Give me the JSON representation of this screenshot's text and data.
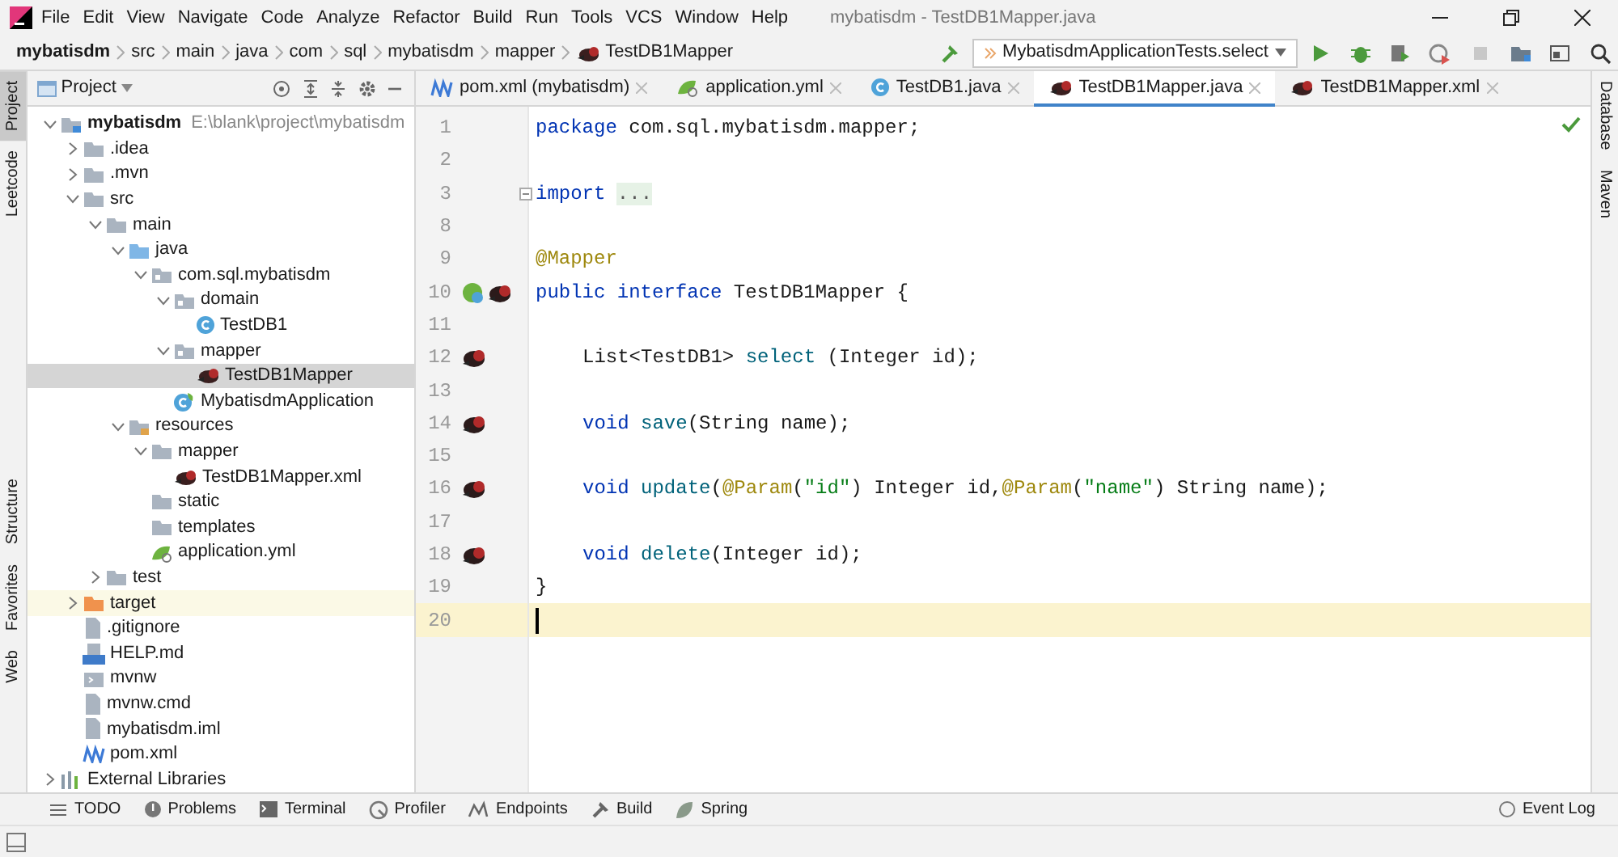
{
  "window": {
    "title": "mybatisdm - TestDB1Mapper.java"
  },
  "menu": [
    "File",
    "Edit",
    "View",
    "Navigate",
    "Code",
    "Analyze",
    "Refactor",
    "Build",
    "Run",
    "Tools",
    "VCS",
    "Window",
    "Help"
  ],
  "breadcrumbs": [
    {
      "label": "mybatisdm",
      "kind": "root"
    },
    {
      "label": "src",
      "kind": "folder"
    },
    {
      "label": "main",
      "kind": "folder"
    },
    {
      "label": "java",
      "kind": "folder"
    },
    {
      "label": "com",
      "kind": "folder"
    },
    {
      "label": "sql",
      "kind": "folder"
    },
    {
      "label": "mybatisdm",
      "kind": "folder"
    },
    {
      "label": "mapper",
      "kind": "folder"
    },
    {
      "label": "TestDB1Mapper",
      "kind": "mapper"
    }
  ],
  "run_config": "MybatisdmApplicationTests.select",
  "left_stripe": [
    {
      "label": "Project",
      "selected": true
    },
    {
      "label": "Leetcode",
      "selected": false
    },
    {
      "label": "Structure",
      "selected": false
    },
    {
      "label": "Favorites",
      "selected": false
    },
    {
      "label": "Web",
      "selected": false
    }
  ],
  "right_stripe": [
    "Database",
    "Maven"
  ],
  "project_panel": {
    "title": "Project",
    "tree": [
      {
        "label": "mybatisdm",
        "hint": "E:\\blank\\project\\mybatisdm",
        "kind": "module",
        "expanded": true,
        "selected": false,
        "highlighted": false,
        "children": [
          {
            "label": ".idea",
            "kind": "folder",
            "expanded": false,
            "selected": false,
            "highlighted": false
          },
          {
            "label": ".mvn",
            "kind": "folder",
            "expanded": false,
            "selected": false,
            "highlighted": false
          },
          {
            "label": "src",
            "kind": "folder",
            "expanded": true,
            "selected": false,
            "highlighted": false,
            "children": [
              {
                "label": "main",
                "kind": "folder",
                "expanded": true,
                "selected": false,
                "highlighted": false,
                "children": [
                  {
                    "label": "java",
                    "kind": "source",
                    "expanded": true,
                    "selected": false,
                    "highlighted": false,
                    "children": [
                      {
                        "label": "com.sql.mybatisdm",
                        "kind": "package",
                        "expanded": true,
                        "selected": false,
                        "highlighted": false,
                        "children": [
                          {
                            "label": "domain",
                            "kind": "package",
                            "expanded": true,
                            "selected": false,
                            "highlighted": false,
                            "children": [
                              {
                                "label": "TestDB1",
                                "kind": "class",
                                "selected": false,
                                "highlighted": false
                              }
                            ]
                          },
                          {
                            "label": "mapper",
                            "kind": "package",
                            "expanded": true,
                            "selected": false,
                            "highlighted": false,
                            "children": [
                              {
                                "label": "TestDB1Mapper",
                                "kind": "mapper",
                                "selected": true,
                                "highlighted": false
                              }
                            ]
                          },
                          {
                            "label": "MybatisdmApplication",
                            "kind": "spring",
                            "selected": false,
                            "highlighted": false
                          }
                        ]
                      }
                    ]
                  },
                  {
                    "label": "resources",
                    "kind": "resources",
                    "expanded": true,
                    "selected": false,
                    "highlighted": false,
                    "children": [
                      {
                        "label": "mapper",
                        "kind": "folder",
                        "expanded": true,
                        "selected": false,
                        "highlighted": false,
                        "children": [
                          {
                            "label": "TestDB1Mapper.xml",
                            "kind": "mapper",
                            "selected": false,
                            "highlighted": false
                          }
                        ]
                      },
                      {
                        "label": "static",
                        "kind": "folder",
                        "selected": false,
                        "highlighted": false
                      },
                      {
                        "label": "templates",
                        "kind": "folder",
                        "selected": false,
                        "highlighted": false
                      },
                      {
                        "label": "application.yml",
                        "kind": "yml",
                        "selected": false,
                        "highlighted": false
                      }
                    ]
                  }
                ]
              },
              {
                "label": "test",
                "kind": "folder",
                "expanded": false,
                "selected": false,
                "highlighted": false
              }
            ]
          },
          {
            "label": "target",
            "kind": "excluded",
            "expanded": false,
            "selected": false,
            "highlighted": true
          },
          {
            "label": ".gitignore",
            "kind": "file",
            "selected": false,
            "highlighted": false
          },
          {
            "label": "HELP.md",
            "kind": "markdown",
            "selected": false,
            "highlighted": false
          },
          {
            "label": "mvnw",
            "kind": "script",
            "selected": false,
            "highlighted": false
          },
          {
            "label": "mvnw.cmd",
            "kind": "file",
            "selected": false,
            "highlighted": false
          },
          {
            "label": "mybatisdm.iml",
            "kind": "file",
            "selected": false,
            "highlighted": false
          },
          {
            "label": "pom.xml",
            "kind": "maven",
            "selected": false,
            "highlighted": false
          }
        ]
      },
      {
        "label": "External Libraries",
        "kind": "libraries",
        "expanded": false,
        "selected": false,
        "highlighted": false
      }
    ]
  },
  "editor_tabs": [
    {
      "label": "pom.xml (mybatisdm)",
      "kind": "maven",
      "selected": false
    },
    {
      "label": "application.yml",
      "kind": "yml",
      "selected": false
    },
    {
      "label": "TestDB1.java",
      "kind": "class",
      "selected": false
    },
    {
      "label": "TestDB1Mapper.java",
      "kind": "mapper",
      "selected": true
    },
    {
      "label": "TestDB1Mapper.xml",
      "kind": "mapper",
      "selected": false
    }
  ],
  "code": [
    {
      "number": "1",
      "indented": false,
      "current": false,
      "tokens": [
        {
          "kind": "keyword",
          "text": "package"
        },
        {
          "kind": "plain",
          "text": " com.sql.mybatisdm.mapper;"
        }
      ]
    },
    {
      "number": "2",
      "current": false
    },
    {
      "number": "3",
      "indented": false,
      "current": false,
      "folded": true,
      "tokens": [
        {
          "kind": "keyword",
          "text": "import "
        },
        {
          "kind": "fold",
          "text": "..."
        }
      ]
    },
    {
      "number": "8",
      "current": false
    },
    {
      "number": "9",
      "indented": false,
      "current": false,
      "tokens": [
        {
          "kind": "annotation",
          "text": "@Mapper"
        }
      ]
    },
    {
      "number": "10",
      "gutter": [
        {
          "kind": "spring"
        },
        {
          "kind": "mybatis"
        }
      ],
      "indented": false,
      "current": false,
      "tokens": [
        {
          "kind": "keyword",
          "text": "public interface"
        },
        {
          "kind": "plain",
          "text": " TestDB1Mapper {"
        }
      ]
    },
    {
      "number": "11",
      "current": false
    },
    {
      "number": "12",
      "gutter": [
        {
          "kind": "mybatis"
        }
      ],
      "indented": true,
      "current": false,
      "tokens": [
        {
          "kind": "plain",
          "text": "List<TestDB1> "
        },
        {
          "kind": "method",
          "text": "select"
        },
        {
          "kind": "plain",
          "text": " (Integer id);"
        }
      ]
    },
    {
      "number": "13",
      "current": false
    },
    {
      "number": "14",
      "gutter": [
        {
          "kind": "mybatis"
        }
      ],
      "indented": true,
      "current": false,
      "tokens": [
        {
          "kind": "keyword",
          "text": "void "
        },
        {
          "kind": "method",
          "text": "save"
        },
        {
          "kind": "plain",
          "text": "(String name);"
        }
      ]
    },
    {
      "number": "15",
      "current": false
    },
    {
      "number": "16",
      "gutter": [
        {
          "kind": "mybatis"
        }
      ],
      "indented": true,
      "current": false,
      "tokens": [
        {
          "kind": "keyword",
          "text": "void "
        },
        {
          "kind": "method",
          "text": "update"
        },
        {
          "kind": "plain",
          "text": "("
        },
        {
          "kind": "annotation",
          "text": "@Param"
        },
        {
          "kind": "plain",
          "text": "("
        },
        {
          "kind": "string",
          "text": "\"id\""
        },
        {
          "kind": "plain",
          "text": ") Integer id,"
        },
        {
          "kind": "annotation",
          "text": "@Param"
        },
        {
          "kind": "plain",
          "text": "("
        },
        {
          "kind": "string",
          "text": "\"name\""
        },
        {
          "kind": "plain",
          "text": ") String name);"
        }
      ]
    },
    {
      "number": "17",
      "current": false
    },
    {
      "number": "18",
      "gutter": [
        {
          "kind": "mybatis"
        }
      ],
      "indented": true,
      "current": false,
      "tokens": [
        {
          "kind": "keyword",
          "text": "void "
        },
        {
          "kind": "method",
          "text": "delete"
        },
        {
          "kind": "plain",
          "text": "(Integer id);"
        }
      ]
    },
    {
      "number": "19",
      "indented": false,
      "current": false,
      "tokens": [
        {
          "kind": "plain",
          "text": "}"
        }
      ]
    },
    {
      "number": "20",
      "current": true
    }
  ],
  "tool_tabs": [
    {
      "label": "TODO",
      "kind": "list"
    },
    {
      "label": "Problems",
      "kind": "problems"
    },
    {
      "label": "Terminal",
      "kind": "terminal"
    },
    {
      "label": "Profiler",
      "kind": "profiler"
    },
    {
      "label": "Endpoints",
      "kind": "endpoints"
    },
    {
      "label": "Build",
      "kind": "build"
    },
    {
      "label": "Spring",
      "kind": "spring"
    }
  ],
  "event_log": "Event Log"
}
